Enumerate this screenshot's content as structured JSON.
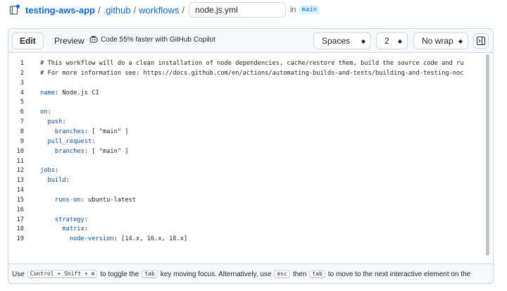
{
  "breadcrumb": {
    "repo": "testing-aws-app",
    "sep1": "/",
    "dir1": ".github",
    "sep2": "/",
    "dir2": "workflows",
    "sep3": "/",
    "filename": "node.js.yml",
    "in_label": "in",
    "branch": "main"
  },
  "toolbar": {
    "edit_label": "Edit",
    "preview_label": "Preview",
    "copilot_label": "Code 55% faster with GitHub Copilot",
    "indent_mode": "Spaces",
    "indent_size": "2",
    "wrap_mode": "No wrap"
  },
  "code_lines": [
    {
      "n": "1",
      "t": "# This workflow will do a clean installation of node dependencies, cache/restore them, build the source code and ru",
      "k": "comment"
    },
    {
      "n": "2",
      "t": "# For more information see: https://docs.github.com/en/actions/automating-builds-and-tests/building-and-testing-noc",
      "k": "comment"
    },
    {
      "n": "3",
      "t": "",
      "k": "plain"
    },
    {
      "n": "4",
      "t": "name: Node.js CI",
      "k": "kv"
    },
    {
      "n": "5",
      "t": "",
      "k": "plain"
    },
    {
      "n": "6",
      "t": "on:",
      "k": "kv"
    },
    {
      "n": "7",
      "t": "  push:",
      "k": "kv"
    },
    {
      "n": "8",
      "t": "    branches: [ \"main\" ]",
      "k": "kv"
    },
    {
      "n": "9",
      "t": "  pull_request:",
      "k": "kv"
    },
    {
      "n": "10",
      "t": "    branches: [ \"main\" ]",
      "k": "kv"
    },
    {
      "n": "11",
      "t": "",
      "k": "plain"
    },
    {
      "n": "12",
      "t": "jobs:",
      "k": "kv"
    },
    {
      "n": "13",
      "t": "  build:",
      "k": "kv"
    },
    {
      "n": "14",
      "t": "",
      "k": "plain"
    },
    {
      "n": "15",
      "t": "    runs-on: ubuntu-latest",
      "k": "kv"
    },
    {
      "n": "16",
      "t": "",
      "k": "plain"
    },
    {
      "n": "17",
      "t": "    strategy:",
      "k": "kv"
    },
    {
      "n": "18",
      "t": "      matrix:",
      "k": "kv"
    },
    {
      "n": "19",
      "t": "        node-version: [14.x, 16.x, 18.x]",
      "k": "kv"
    }
  ],
  "hint": {
    "p1": "Use",
    "k1": "Control + Shift + m",
    "p2": "to toggle the",
    "k2": "tab",
    "p3": "key moving focus. Alternatively, use",
    "k3": "esc",
    "p4": "then",
    "k4": "tab",
    "p5": "to move to the next interactive element on the"
  },
  "icons": {
    "repo": "repo-icon",
    "copilot": "copilot-icon",
    "panel": "sidebar-panel-icon"
  },
  "colors": {
    "link": "#0969da",
    "key": "#0550ae",
    "border": "#d0d7de"
  }
}
